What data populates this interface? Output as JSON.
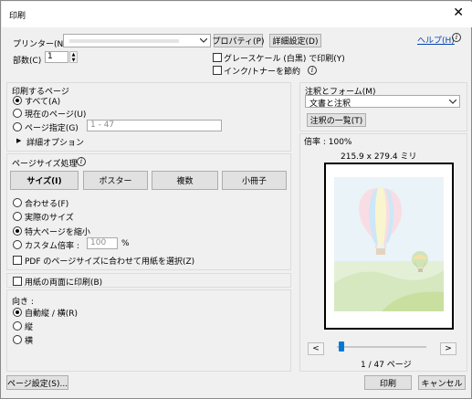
{
  "window": {
    "title": "印刷",
    "close_glyph": "✕"
  },
  "header": {
    "printer_label": "プリンター(N) :",
    "properties_button": "プロパティ(P)",
    "advanced_button": "詳細設定(D)",
    "help_link": "ヘルプ(H)",
    "help_icon": "help-icon",
    "copies_label": "部数(C) :",
    "copies_value": "1",
    "grayscale_label": "グレースケール (白黒) で印刷(Y)",
    "save_ink_label": "インク/トナーを節約",
    "info_glyph": "i"
  },
  "pages": {
    "heading": "印刷するページ",
    "all": "すべて(A)",
    "current": "現在のページ(U)",
    "specify": "ページ指定(G)",
    "specify_placeholder": "1 - 47",
    "more_options": "詳細オプション"
  },
  "sizing": {
    "heading": "ページサイズ処理",
    "tabs": [
      "サイズ(I)",
      "ポスター",
      "複数",
      "小冊子"
    ],
    "fit": "合わせる(F)",
    "actual": "実際のサイズ",
    "shrink": "特大ページを縮小",
    "custom": "カスタム倍率 :",
    "custom_value": "100",
    "percent": "%",
    "pdf_paper": "PDF のページサイズに合わせて用紙を選択(Z)"
  },
  "duplex": {
    "label": "用紙の両面に印刷(B)"
  },
  "orientation": {
    "heading": "向き :",
    "auto": "自動縦 / 横(R)",
    "portrait": "縦",
    "landscape": "横"
  },
  "comments": {
    "heading": "注釈とフォーム(M)",
    "select_value": "文書と注釈",
    "summary_button": "注釈の一覧(T)"
  },
  "preview": {
    "scale": "倍率 : 100%",
    "dimensions": "215.9 x 279.4 ミリ",
    "prev": "<",
    "next": ">",
    "page_of": "1 / 47 ページ",
    "slider_position": 0.02
  },
  "footer": {
    "page_setup_button": "ページ設定(S)...",
    "print_button": "印刷",
    "cancel_button": "キャンセル"
  },
  "colors": {
    "accent": "#0078d7",
    "link": "#0645ad"
  }
}
